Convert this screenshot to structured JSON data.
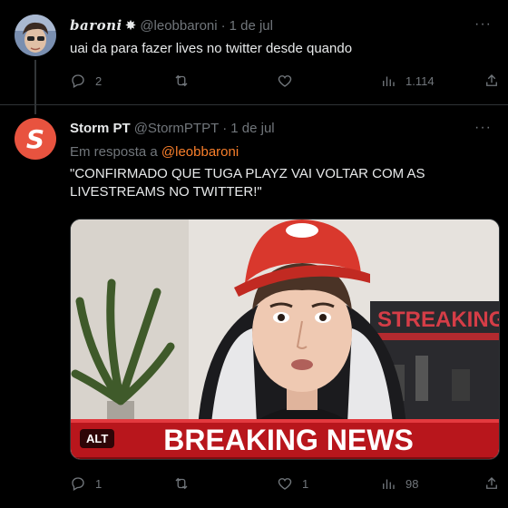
{
  "tweet1": {
    "display_name": "baroni",
    "verified_symbol": "✸",
    "handle": "@leobbaroni",
    "separator": "·",
    "date": "1 de jul",
    "text": "uai da para fazer lives no twitter desde quando",
    "replies": "2",
    "retweets": "",
    "likes": "",
    "views": "1.114"
  },
  "tweet2": {
    "display_name": "Storm PT",
    "handle": "@StormPTPT",
    "separator": "·",
    "date": "1 de jul",
    "avatar_letter": "S",
    "reply_prefix": "Em resposta a",
    "reply_mention": "@leobbaroni",
    "text": "\"CONFIRMADO QUE TUGA PLAYZ VAI VOLTAR COM AS LIVESTREAMS NO TWITTER!\"",
    "media": {
      "banner_text": "BREAKING NEWS",
      "sign_text": "STREAKING",
      "alt_label": "ALT"
    },
    "replies": "1",
    "retweets": "",
    "likes": "1",
    "views": "98"
  },
  "more_label": "···",
  "colors": {
    "background": "#000000",
    "text": "#e7e9ea",
    "muted": "#71767b",
    "mention": "#f97f2b",
    "avatar_bg": "#e8533f",
    "banner_red": "#c0141b"
  }
}
